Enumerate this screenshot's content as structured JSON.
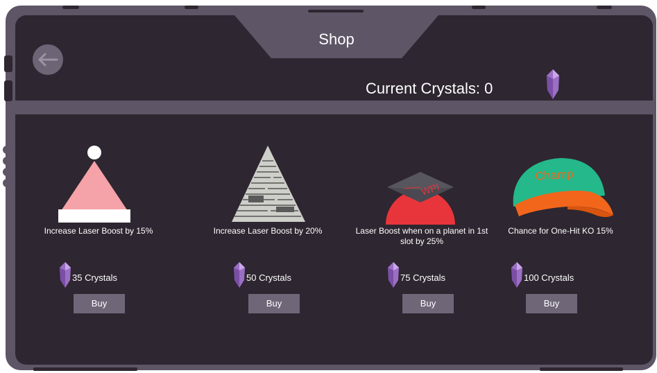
{
  "header": {
    "title": "Shop",
    "crystals_label": "Current Crystals: 0"
  },
  "items": [
    {
      "description": "Increase Laser Boost by 15%",
      "price": "35 Crystals",
      "buy_label": "Buy",
      "icon": "santa-hat-icon"
    },
    {
      "description": "Increase Laser Boost by 20%",
      "price": "50 Crystals",
      "buy_label": "Buy",
      "icon": "newspaper-hat-icon"
    },
    {
      "description": "Laser Boost when on a planet in 1st slot by 25%",
      "price": "75 Crystals",
      "buy_label": "Buy",
      "icon": "graduation-cap-icon"
    },
    {
      "description": "Chance for One-Hit KO 15%",
      "price": "100 Crystals",
      "buy_label": "Buy",
      "icon": "champ-cap-icon",
      "cap_text": "Champ"
    }
  ],
  "colors": {
    "panel": "#2e2630",
    "frame": "#5e5566",
    "button": "#6f6678",
    "crystal": "#9a6fc4"
  }
}
